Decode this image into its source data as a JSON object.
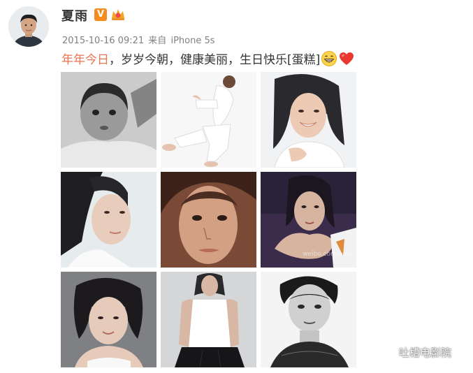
{
  "post": {
    "username": "夏雨",
    "verified_badge": "V",
    "badge_icon": "vip-crown-icon",
    "timestamp": "2015-10-16 09:21",
    "source_prefix": "来自",
    "source_device": "iPhone 5s",
    "text_highlight": "年年今日",
    "text_body": "，岁岁今朝，健康美丽，生日快乐[蛋糕]",
    "emojis": [
      "grin-emoji",
      "heart-emoji"
    ]
  },
  "photos": [
    {
      "name": "photo-child-bw"
    },
    {
      "name": "photo-white-outfit"
    },
    {
      "name": "photo-smiling-portrait"
    },
    {
      "name": "photo-side-portrait"
    },
    {
      "name": "photo-closeup-face"
    },
    {
      "name": "photo-purple-portrait",
      "watermark": "weibo.com/aoqi"
    },
    {
      "name": "photo-bob-haircut"
    },
    {
      "name": "photo-white-tank-top"
    },
    {
      "name": "photo-short-hair-bw"
    }
  ],
  "footer": {
    "brand_label": "吐槽电影院",
    "brand_icon": "wechat-icon"
  },
  "colors": {
    "highlight": "#eb7350",
    "meta": "#808080",
    "text": "#333333",
    "badge": "#f78a1f"
  }
}
